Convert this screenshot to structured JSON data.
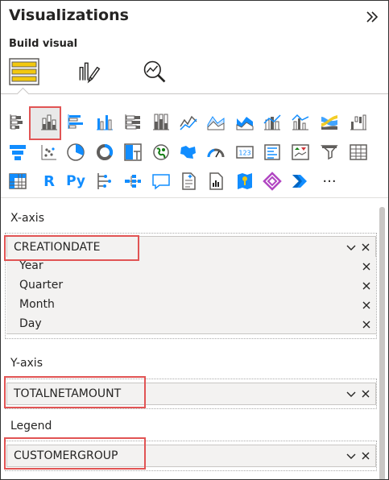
{
  "pane": {
    "title": "Visualizations",
    "build_label": "Build visual"
  },
  "modes": [
    "build-visual-icon",
    "format-visual-icon",
    "analytics-icon"
  ],
  "viz_icons": {
    "row1": [
      "stacked-bar-chart-icon",
      "stacked-column-chart-icon",
      "clustered-bar-chart-icon",
      "clustered-column-chart-icon",
      "100-stacked-bar-chart-icon",
      "100-stacked-column-chart-icon",
      "line-chart-icon",
      "area-chart-icon",
      "stacked-area-chart-icon",
      "line-and-stacked-column-icon",
      "line-and-clustered-column-icon",
      "ribbon-chart-icon",
      "waterfall-chart-icon"
    ],
    "row2": [
      "funnel-icon",
      "scatter-chart-icon",
      "pie-chart-icon",
      "donut-chart-icon",
      "treemap-icon",
      "map-icon",
      "filled-map-icon",
      "gauge-icon",
      "card-icon",
      "multi-row-card-icon",
      "kpi-icon",
      "slicer-icon",
      "table-icon"
    ],
    "row3": [
      "matrix-icon",
      "r-visual-icon",
      "python-visual-icon",
      "key-influencers-icon",
      "decomposition-tree-icon",
      "qa-icon",
      "smart-narrative-icon",
      "paginated-report-icon",
      "azure-map-icon",
      "power-apps-icon",
      "power-automate-icon",
      "more-visuals-icon"
    ],
    "r_label": "R",
    "py_label": "Py",
    "more_label": "···"
  },
  "wells": {
    "x_axis": {
      "label": "X-axis",
      "field": "CREATIONDATE",
      "hierarchy": [
        "Year",
        "Quarter",
        "Month",
        "Day"
      ]
    },
    "y_axis": {
      "label": "Y-axis",
      "field": "TOTALNETAMOUNT"
    },
    "legend": {
      "label": "Legend",
      "field": "CUSTOMERGROUP"
    }
  },
  "colors": {
    "highlight": "#e15454",
    "accent_yellow": "#f2c80f",
    "icon_gray": "#605e5c",
    "icon_blue": "#118dff"
  }
}
